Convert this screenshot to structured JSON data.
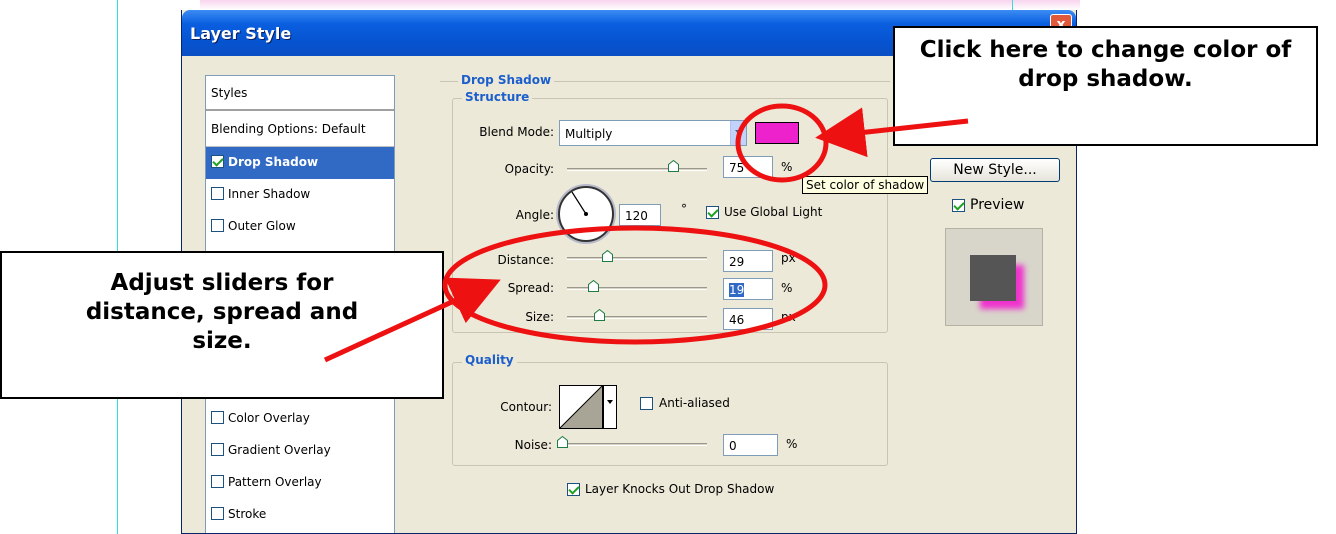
{
  "dialog": {
    "title": "Layer Style",
    "close_symbol": "x"
  },
  "styles_panel": {
    "header": "Styles",
    "blending_options": "Blending Options: Default",
    "items": [
      {
        "label": "Drop Shadow",
        "checked": true,
        "selected": true
      },
      {
        "label": "Inner Shadow",
        "checked": false,
        "selected": false
      },
      {
        "label": "Outer Glow",
        "checked": false,
        "selected": false
      },
      {
        "label": "Color Overlay",
        "checked": false,
        "selected": false
      },
      {
        "label": "Gradient Overlay",
        "checked": false,
        "selected": false
      },
      {
        "label": "Pattern Overlay",
        "checked": false,
        "selected": false
      },
      {
        "label": "Stroke",
        "checked": false,
        "selected": false
      }
    ]
  },
  "drop_shadow": {
    "section_title": "Drop Shadow",
    "structure_title": "Structure",
    "blend_mode_label": "Blend Mode:",
    "blend_mode_value": "Multiply",
    "shadow_color": "#ee22cc",
    "opacity_label": "Opacity:",
    "opacity_value": "75",
    "opacity_unit": "%",
    "angle_label": "Angle:",
    "angle_value": "120",
    "angle_unit": "°",
    "use_global_light_label": "Use Global Light",
    "use_global_light_checked": true,
    "distance_label": "Distance:",
    "distance_value": "29",
    "distance_unit": "px",
    "spread_label": "Spread:",
    "spread_value": "19",
    "spread_unit": "%",
    "size_label": "Size:",
    "size_value": "46",
    "size_unit": "px"
  },
  "quality": {
    "section_title": "Quality",
    "contour_label": "Contour:",
    "anti_aliased_label": "Anti-aliased",
    "anti_aliased_checked": false,
    "noise_label": "Noise:",
    "noise_value": "0",
    "noise_unit": "%",
    "layer_knocks_out_label": "Layer Knocks Out Drop Shadow",
    "layer_knocks_out_checked": true
  },
  "right_panel": {
    "new_style_button": "New Style...",
    "preview_label": "Preview",
    "preview_checked": true
  },
  "tooltip": "Set color of shadow",
  "annotations": {
    "color_callout": "Click here to change color of drop shadow.",
    "sliders_callout": "Adjust sliders for distance, spread and size.",
    "annotation_color": "#ee1111"
  }
}
